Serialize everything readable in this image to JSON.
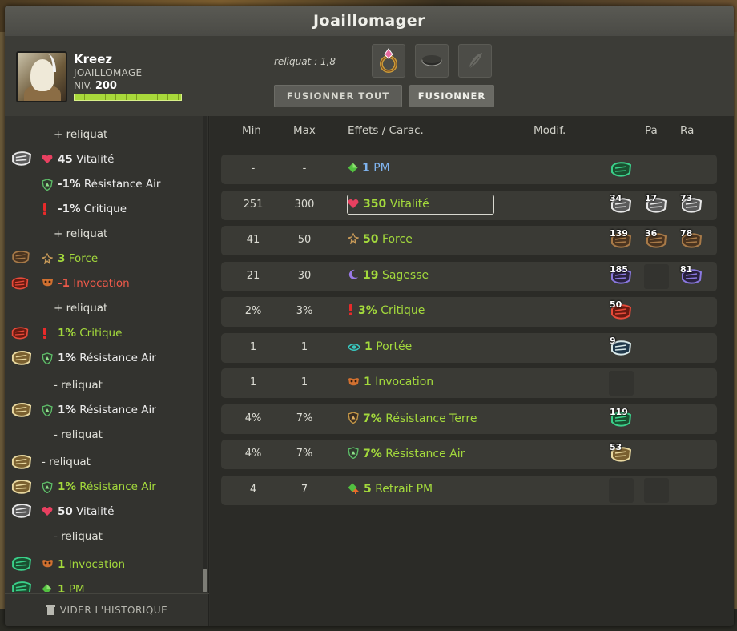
{
  "window": {
    "title": "Joaillomager"
  },
  "player": {
    "name": "Kreez",
    "job": "JOAILLOMAGE",
    "level_label": "NIV.",
    "level": "200",
    "xp_fraction": 1.0
  },
  "reliquat_text": "reliquat : 1,8",
  "buttons": {
    "fuse_all": "FUSIONNER TOUT",
    "fuse": "FUSIONNER"
  },
  "history": {
    "clear_label": "VIDER L'HISTORIQUE",
    "rows": [
      {
        "kind": "sub",
        "text": "+ reliquat"
      },
      {
        "kind": "effect",
        "rune": "white-claw",
        "icon": "heart",
        "value": "45",
        "label": "Vitalité",
        "color": "white"
      },
      {
        "kind": "effect",
        "rune": "",
        "icon": "shield-air",
        "value": "-1%",
        "label": "Résistance Air",
        "color": "white"
      },
      {
        "kind": "effect",
        "rune": "",
        "icon": "crit",
        "value": "-1%",
        "label": "Critique",
        "color": "white"
      },
      {
        "kind": "sub",
        "text": "+ reliquat"
      },
      {
        "kind": "effect",
        "rune": "brown-claw",
        "icon": "force",
        "value": "3",
        "label": "Force",
        "color": "green"
      },
      {
        "kind": "effect",
        "rune": "red-rune",
        "icon": "invoc",
        "value": "-1",
        "label": "Invocation",
        "color": "red"
      },
      {
        "kind": "sub",
        "text": "+ reliquat"
      },
      {
        "kind": "effect",
        "rune": "red-rune",
        "icon": "crit",
        "value": "1%",
        "label": "Critique",
        "color": "green"
      },
      {
        "kind": "effect",
        "rune": "gold-claw",
        "icon": "shield-air",
        "value": "1%",
        "label": "Résistance Air",
        "color": "white"
      },
      {
        "kind": "sub",
        "text": "- reliquat"
      },
      {
        "kind": "effect",
        "rune": "gold-claw",
        "icon": "shield-air",
        "value": "1%",
        "label": "Résistance Air",
        "color": "white"
      },
      {
        "kind": "sub",
        "text": "- reliquat"
      },
      {
        "kind": "plain",
        "rune": "gold-claw",
        "text": "- reliquat"
      },
      {
        "kind": "effect",
        "rune": "gold-claw",
        "icon": "shield-air",
        "value": "1%",
        "label": "Résistance Air",
        "color": "green"
      },
      {
        "kind": "effect",
        "rune": "white-claw",
        "icon": "heart",
        "value": "50",
        "label": "Vitalité",
        "color": "white"
      },
      {
        "kind": "sub",
        "text": "- reliquat"
      },
      {
        "kind": "effect",
        "rune": "green-claw",
        "icon": "invoc",
        "value": "1",
        "label": "Invocation",
        "color": "green"
      },
      {
        "kind": "effect",
        "rune": "green-claw2",
        "icon": "pm",
        "value": "1",
        "label": "PM",
        "color": "green"
      }
    ]
  },
  "table": {
    "headers": {
      "min": "Min",
      "max": "Max",
      "effects": "Effets / Carac.",
      "modif": "Modif.",
      "pa": "Pa",
      "ra": "Ra"
    },
    "rows": [
      {
        "min": "-",
        "max": "-",
        "icon": "pm",
        "value": "1",
        "label": "PM",
        "color": "#7fb3ee",
        "runes": [
          {
            "n": "",
            "kind": "green"
          },
          null,
          null
        ]
      },
      {
        "min": "251",
        "max": "300",
        "icon": "heart",
        "value": "350",
        "label": "Vitalité",
        "color": "#a3d93c",
        "selected": true,
        "runes": [
          {
            "n": "34",
            "kind": "white"
          },
          {
            "n": "17",
            "kind": "white"
          },
          {
            "n": "73",
            "kind": "white"
          }
        ]
      },
      {
        "min": "41",
        "max": "50",
        "icon": "force",
        "value": "50",
        "label": "Force",
        "color": "#a3d93c",
        "runes": [
          {
            "n": "139",
            "kind": "brown"
          },
          {
            "n": "36",
            "kind": "brown"
          },
          {
            "n": "78",
            "kind": "brown"
          }
        ]
      },
      {
        "min": "21",
        "max": "30",
        "icon": "sagesse",
        "value": "19",
        "label": "Sagesse",
        "color": "#a3d93c",
        "runes": [
          {
            "n": "185",
            "kind": "purple"
          },
          {
            "n": "",
            "kind": "empty"
          },
          {
            "n": "81",
            "kind": "purple"
          }
        ]
      },
      {
        "min": "2%",
        "max": "3%",
        "icon": "crit",
        "value": "3%",
        "label": "Critique",
        "color": "#a3d93c",
        "runes": [
          {
            "n": "50",
            "kind": "red"
          },
          null,
          null
        ]
      },
      {
        "min": "1",
        "max": "1",
        "icon": "eye",
        "value": "1",
        "label": "Portée",
        "color": "#a3d93c",
        "runes": [
          {
            "n": "9",
            "kind": "teal"
          },
          null,
          null
        ]
      },
      {
        "min": "1",
        "max": "1",
        "icon": "invoc",
        "value": "1",
        "label": "Invocation",
        "color": "#a3d93c",
        "runes": [
          {
            "n": "",
            "kind": "empty"
          },
          null,
          null
        ]
      },
      {
        "min": "4%",
        "max": "7%",
        "icon": "shield-earth",
        "value": "7%",
        "label": "Résistance Terre",
        "color": "#a3d93c",
        "runes": [
          {
            "n": "119",
            "kind": "green"
          },
          null,
          null
        ]
      },
      {
        "min": "4%",
        "max": "7%",
        "icon": "shield-air",
        "value": "7%",
        "label": "Résistance Air",
        "color": "#a3d93c",
        "runes": [
          {
            "n": "53",
            "kind": "gold"
          },
          null,
          null
        ]
      },
      {
        "min": "4",
        "max": "7",
        "icon": "retrait-pm",
        "value": "5",
        "label": "Retrait PM",
        "color": "#a3d93c",
        "runes": [
          {
            "n": "",
            "kind": "empty"
          },
          {
            "n": "",
            "kind": "empty"
          },
          null
        ]
      }
    ]
  }
}
